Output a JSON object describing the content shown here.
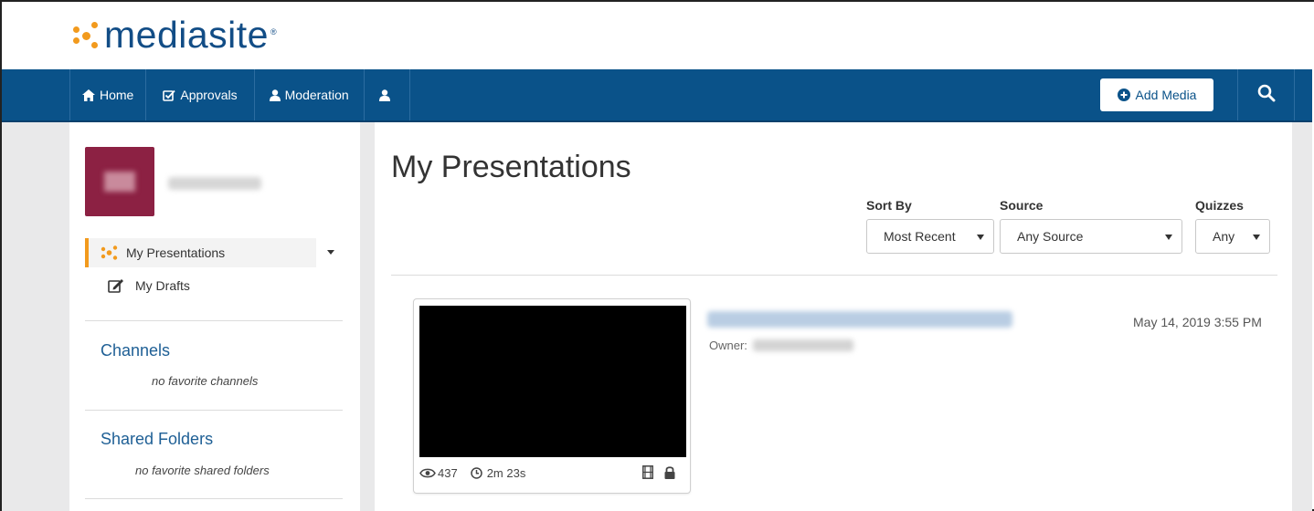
{
  "brand": {
    "logo_text": "mediasite",
    "logo_mark": "®",
    "accent": "#f29a1d",
    "primary": "#0a5289"
  },
  "nav": {
    "items": [
      {
        "label": "Home",
        "icon": "home-icon"
      },
      {
        "label": "Approvals",
        "icon": "check-square-icon"
      },
      {
        "label": "Moderation",
        "icon": "user-icon"
      },
      {
        "label": "",
        "icon": "user-icon"
      }
    ],
    "add_media_label": "Add Media",
    "search_icon": "search-icon"
  },
  "sidebar": {
    "items": [
      {
        "label": "My Presentations",
        "icon": "mediasite-dots-icon",
        "active": true
      },
      {
        "label": "My Drafts",
        "icon": "edit-icon",
        "active": false
      }
    ],
    "sections": [
      {
        "title": "Channels",
        "empty_text": "no favorite channels"
      },
      {
        "title": "Shared Folders",
        "empty_text": "no favorite shared folders"
      }
    ]
  },
  "main": {
    "title": "My Presentations",
    "filters": [
      {
        "label": "Sort By",
        "value": "Most Recent"
      },
      {
        "label": "Source",
        "value": "Any Source"
      },
      {
        "label": "Quizzes",
        "value": "Any"
      }
    ],
    "presentations": [
      {
        "views": "437",
        "duration": "2m 23s",
        "owner_label": "Owner:",
        "date": "May 14, 2019 3:55 PM"
      }
    ]
  }
}
